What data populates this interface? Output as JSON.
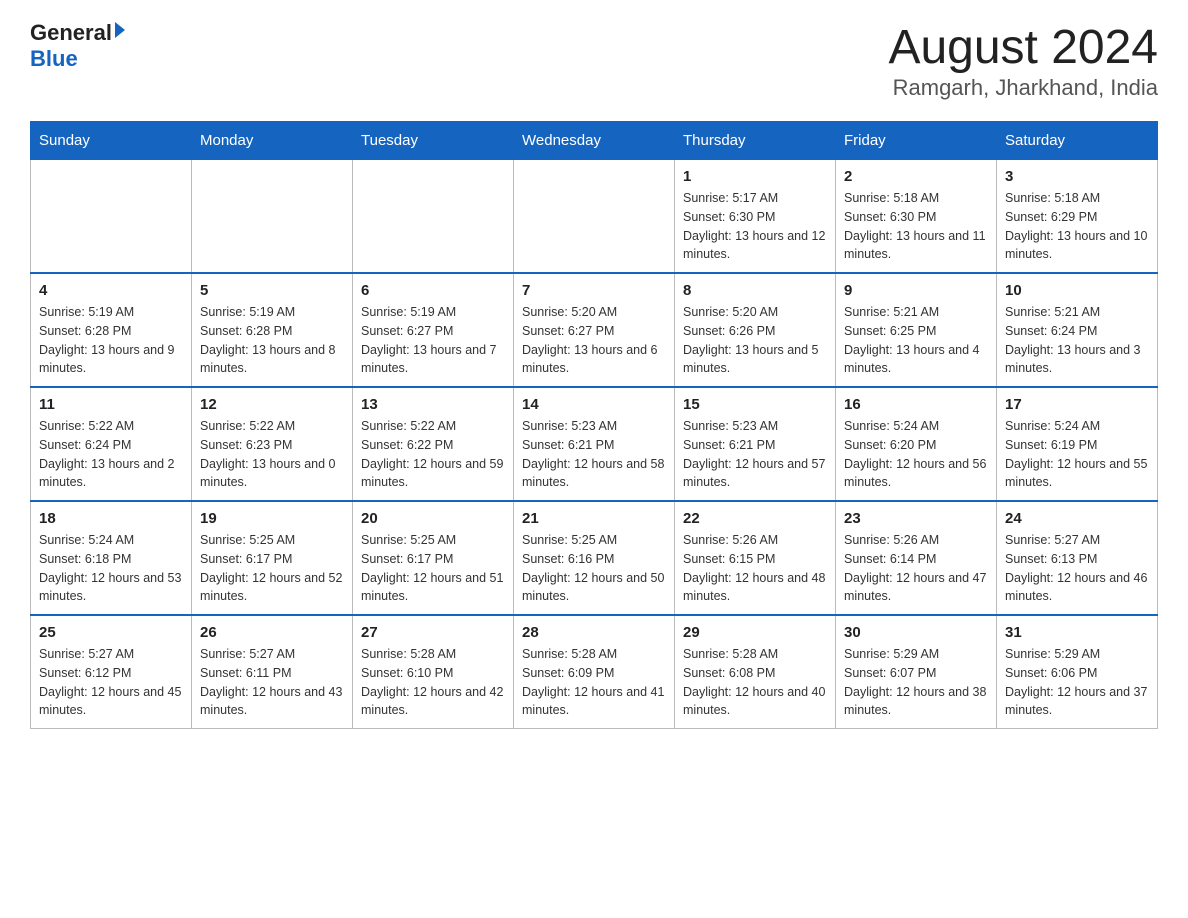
{
  "header": {
    "logo_general": "General",
    "logo_blue": "Blue",
    "title": "August 2024",
    "subtitle": "Ramgarh, Jharkhand, India"
  },
  "weekdays": [
    "Sunday",
    "Monday",
    "Tuesday",
    "Wednesday",
    "Thursday",
    "Friday",
    "Saturday"
  ],
  "weeks": [
    [
      {
        "day": "",
        "info": ""
      },
      {
        "day": "",
        "info": ""
      },
      {
        "day": "",
        "info": ""
      },
      {
        "day": "",
        "info": ""
      },
      {
        "day": "1",
        "info": "Sunrise: 5:17 AM\nSunset: 6:30 PM\nDaylight: 13 hours and 12 minutes."
      },
      {
        "day": "2",
        "info": "Sunrise: 5:18 AM\nSunset: 6:30 PM\nDaylight: 13 hours and 11 minutes."
      },
      {
        "day": "3",
        "info": "Sunrise: 5:18 AM\nSunset: 6:29 PM\nDaylight: 13 hours and 10 minutes."
      }
    ],
    [
      {
        "day": "4",
        "info": "Sunrise: 5:19 AM\nSunset: 6:28 PM\nDaylight: 13 hours and 9 minutes."
      },
      {
        "day": "5",
        "info": "Sunrise: 5:19 AM\nSunset: 6:28 PM\nDaylight: 13 hours and 8 minutes."
      },
      {
        "day": "6",
        "info": "Sunrise: 5:19 AM\nSunset: 6:27 PM\nDaylight: 13 hours and 7 minutes."
      },
      {
        "day": "7",
        "info": "Sunrise: 5:20 AM\nSunset: 6:27 PM\nDaylight: 13 hours and 6 minutes."
      },
      {
        "day": "8",
        "info": "Sunrise: 5:20 AM\nSunset: 6:26 PM\nDaylight: 13 hours and 5 minutes."
      },
      {
        "day": "9",
        "info": "Sunrise: 5:21 AM\nSunset: 6:25 PM\nDaylight: 13 hours and 4 minutes."
      },
      {
        "day": "10",
        "info": "Sunrise: 5:21 AM\nSunset: 6:24 PM\nDaylight: 13 hours and 3 minutes."
      }
    ],
    [
      {
        "day": "11",
        "info": "Sunrise: 5:22 AM\nSunset: 6:24 PM\nDaylight: 13 hours and 2 minutes."
      },
      {
        "day": "12",
        "info": "Sunrise: 5:22 AM\nSunset: 6:23 PM\nDaylight: 13 hours and 0 minutes."
      },
      {
        "day": "13",
        "info": "Sunrise: 5:22 AM\nSunset: 6:22 PM\nDaylight: 12 hours and 59 minutes."
      },
      {
        "day": "14",
        "info": "Sunrise: 5:23 AM\nSunset: 6:21 PM\nDaylight: 12 hours and 58 minutes."
      },
      {
        "day": "15",
        "info": "Sunrise: 5:23 AM\nSunset: 6:21 PM\nDaylight: 12 hours and 57 minutes."
      },
      {
        "day": "16",
        "info": "Sunrise: 5:24 AM\nSunset: 6:20 PM\nDaylight: 12 hours and 56 minutes."
      },
      {
        "day": "17",
        "info": "Sunrise: 5:24 AM\nSunset: 6:19 PM\nDaylight: 12 hours and 55 minutes."
      }
    ],
    [
      {
        "day": "18",
        "info": "Sunrise: 5:24 AM\nSunset: 6:18 PM\nDaylight: 12 hours and 53 minutes."
      },
      {
        "day": "19",
        "info": "Sunrise: 5:25 AM\nSunset: 6:17 PM\nDaylight: 12 hours and 52 minutes."
      },
      {
        "day": "20",
        "info": "Sunrise: 5:25 AM\nSunset: 6:17 PM\nDaylight: 12 hours and 51 minutes."
      },
      {
        "day": "21",
        "info": "Sunrise: 5:25 AM\nSunset: 6:16 PM\nDaylight: 12 hours and 50 minutes."
      },
      {
        "day": "22",
        "info": "Sunrise: 5:26 AM\nSunset: 6:15 PM\nDaylight: 12 hours and 48 minutes."
      },
      {
        "day": "23",
        "info": "Sunrise: 5:26 AM\nSunset: 6:14 PM\nDaylight: 12 hours and 47 minutes."
      },
      {
        "day": "24",
        "info": "Sunrise: 5:27 AM\nSunset: 6:13 PM\nDaylight: 12 hours and 46 minutes."
      }
    ],
    [
      {
        "day": "25",
        "info": "Sunrise: 5:27 AM\nSunset: 6:12 PM\nDaylight: 12 hours and 45 minutes."
      },
      {
        "day": "26",
        "info": "Sunrise: 5:27 AM\nSunset: 6:11 PM\nDaylight: 12 hours and 43 minutes."
      },
      {
        "day": "27",
        "info": "Sunrise: 5:28 AM\nSunset: 6:10 PM\nDaylight: 12 hours and 42 minutes."
      },
      {
        "day": "28",
        "info": "Sunrise: 5:28 AM\nSunset: 6:09 PM\nDaylight: 12 hours and 41 minutes."
      },
      {
        "day": "29",
        "info": "Sunrise: 5:28 AM\nSunset: 6:08 PM\nDaylight: 12 hours and 40 minutes."
      },
      {
        "day": "30",
        "info": "Sunrise: 5:29 AM\nSunset: 6:07 PM\nDaylight: 12 hours and 38 minutes."
      },
      {
        "day": "31",
        "info": "Sunrise: 5:29 AM\nSunset: 6:06 PM\nDaylight: 12 hours and 37 minutes."
      }
    ]
  ]
}
